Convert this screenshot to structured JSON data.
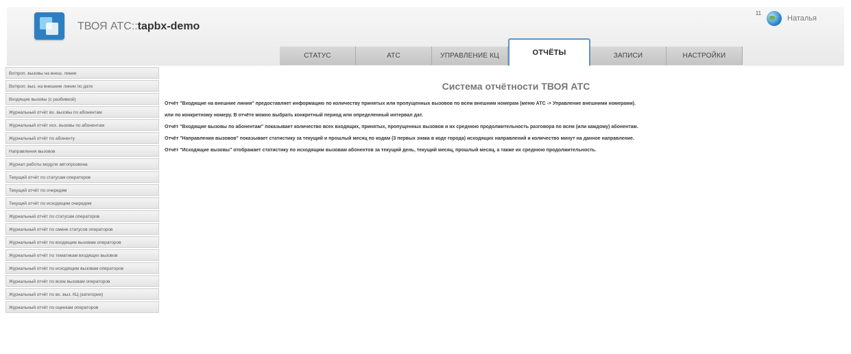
{
  "header": {
    "brand_prefix": "ТВОЯ АТС::",
    "brand_instance": "tapbx-demo",
    "counter": "11",
    "username": "Наталья"
  },
  "tabs": [
    {
      "label": "СТАТУС"
    },
    {
      "label": "АТС"
    },
    {
      "label": "УПРАВЛЕНИЕ КЦ"
    },
    {
      "label": "ОТЧЁТЫ",
      "active": true
    },
    {
      "label": "ЗАПИСИ"
    },
    {
      "label": "НАСТРОЙКИ"
    }
  ],
  "sidebar": {
    "items": [
      {
        "label": "Вх/проп. вызовы на внеш. линии"
      },
      {
        "label": "Вх/проп. выз. на внешние линии по дате"
      },
      {
        "label": "Входящие вызовы (с разбивкой)"
      },
      {
        "label": "Журнальный отчёт вх. вызовы по абонентам"
      },
      {
        "label": "Журнальный отчёт исх. вызовы по абонентам"
      },
      {
        "label": "Журнальный отчёт по абоненту"
      },
      {
        "label": "Направления вызовов"
      },
      {
        "label": "Журнал работы модуля автопрозвона"
      },
      {
        "label": "Текущий отчёт по статусам операторов"
      },
      {
        "label": "Текущий отчёт по очередям"
      },
      {
        "label": "Текущий отчёт по исходящим очередям"
      },
      {
        "label": "Журнальный отчёт по статусам операторов"
      },
      {
        "label": "Журнальный отчёт по смене статусов операторов"
      },
      {
        "label": "Журнальный отчёт по входящим вызовам операторов"
      },
      {
        "label": "Журнальный отчёт по тематикам входящих вызовов"
      },
      {
        "label": "Журнальный отчёт по исходящим вызовам операторов"
      },
      {
        "label": "Журнальный отчёт по всем вызовам операторов"
      },
      {
        "label": "Журнальный отчёт по вх. выз. КЦ (категории)"
      },
      {
        "label": "Журнальный отчёт по оценкам операторов"
      }
    ]
  },
  "content": {
    "title": "Система отчётности ТВОЯ АТС",
    "paragraphs": [
      "Отчёт \"Входящие на внешние линии\" предоставляет информацию по количеству принятых или пропущенных вызовов по всем внешним номерам (меню АТС -> Управление внешними номерами).",
      "или по конкретному номеру. В отчёте можно выбрать конкретный период или определенный интервал дат.",
      "Отчёт \"Входящие вызовы по абонентам\" показывает количество всех входящих, принятых, пропущенных вызовов и их среднюю продолжительность разговора по всем (или каждому) абонентам.",
      "Отчёт \"Направления вызовов\" показывает статистику за текущий и прошлый месяц по кодам (3 первых знака в коде города) исходящих направлений и количество минут на данное направление.",
      "Отчёт \"Исходящие вызовы\" отображает статистику по исходящим вызовам абонентов за текущий день, текущий месяц, прошлый месяц, а также их среднюю продолжительность."
    ]
  },
  "icons": {
    "logo": "app-logo-icon",
    "globe": "globe-icon"
  },
  "colors": {
    "active_tab_border": "#5f94c9",
    "logo_blue": "#2e7fc2"
  }
}
